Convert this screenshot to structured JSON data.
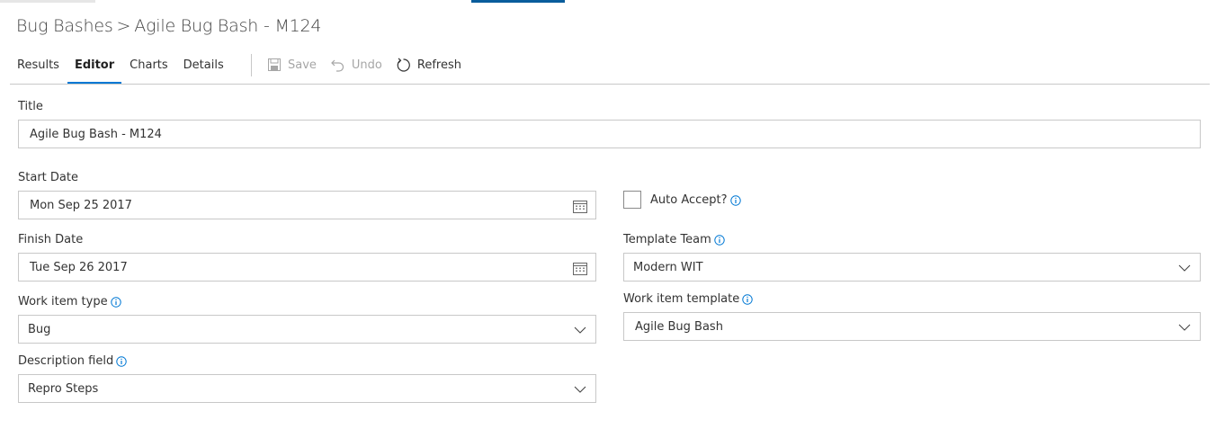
{
  "breadcrumb": {
    "root": "Bug Bashes",
    "separator": ">",
    "current": "Agile Bug Bash - M124"
  },
  "tabs": [
    {
      "label": "Results",
      "active": false
    },
    {
      "label": "Editor",
      "active": true
    },
    {
      "label": "Charts",
      "active": false
    },
    {
      "label": "Details",
      "active": false
    }
  ],
  "toolbar": {
    "save_label": "Save",
    "undo_label": "Undo",
    "refresh_label": "Refresh"
  },
  "form": {
    "title_label": "Title",
    "title_value": "Agile Bug Bash - M124",
    "start_date_label": "Start Date",
    "start_date_value": "Mon Sep 25 2017",
    "finish_date_label": "Finish Date",
    "finish_date_value": "Tue Sep 26 2017",
    "work_item_type_label": "Work item type",
    "work_item_type_value": "Bug",
    "description_field_label": "Description field",
    "description_field_value": "Repro Steps",
    "auto_accept_label": "Auto Accept?",
    "auto_accept_checked": false,
    "template_team_label": "Template Team",
    "template_team_value": "Modern WIT",
    "work_item_template_label": "Work item template",
    "work_item_template_value": "Agile Bug Bash"
  },
  "colors": {
    "accent": "#0078d4",
    "info_icon": "#0078d4",
    "border": "#c8c8c8",
    "disabled_text": "#a6a6a6"
  }
}
